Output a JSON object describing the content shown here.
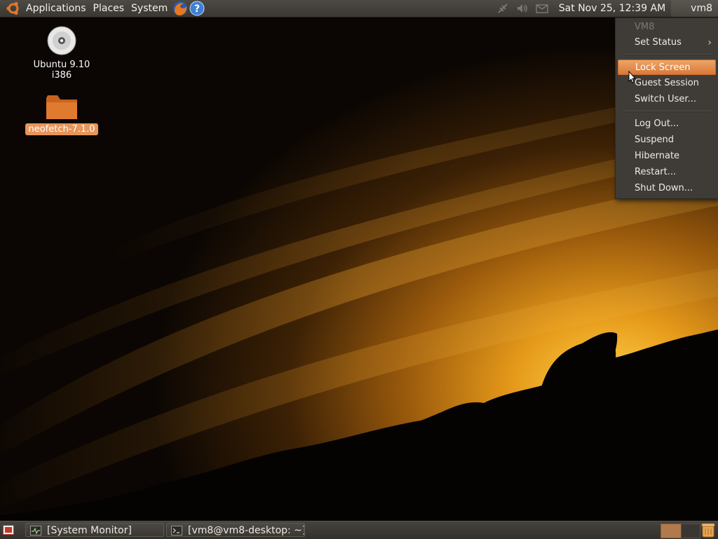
{
  "top_panel": {
    "menus": [
      "Applications",
      "Places",
      "System"
    ],
    "clock": "Sat Nov 25, 12:39 AM",
    "user": "vm8"
  },
  "desktop": {
    "icons": [
      {
        "label": "Ubuntu 9.10 i386",
        "icon": "cd-icon"
      },
      {
        "label": "neofetch-7.1.0",
        "icon": "folder-icon",
        "selected": true
      }
    ]
  },
  "user_menu": {
    "header": "VM8",
    "set_status": "Set Status",
    "lock_screen": "Lock Screen",
    "guest_session": "Guest Session",
    "switch_user": "Switch User...",
    "log_out": "Log Out...",
    "suspend": "Suspend",
    "hibernate": "Hibernate",
    "restart": "Restart...",
    "shut_down": "Shut Down...",
    "highlighted": "Lock Screen"
  },
  "bottom_panel": {
    "tasks": [
      {
        "label": "[System Monitor]",
        "icon": "system-monitor-icon"
      },
      {
        "label": "[vm8@vm8-desktop: ~]",
        "icon": "terminal-icon"
      }
    ]
  },
  "colors": {
    "panel": "#3f3c38",
    "highlight": "#e0823e",
    "selection": "#e7955a"
  }
}
